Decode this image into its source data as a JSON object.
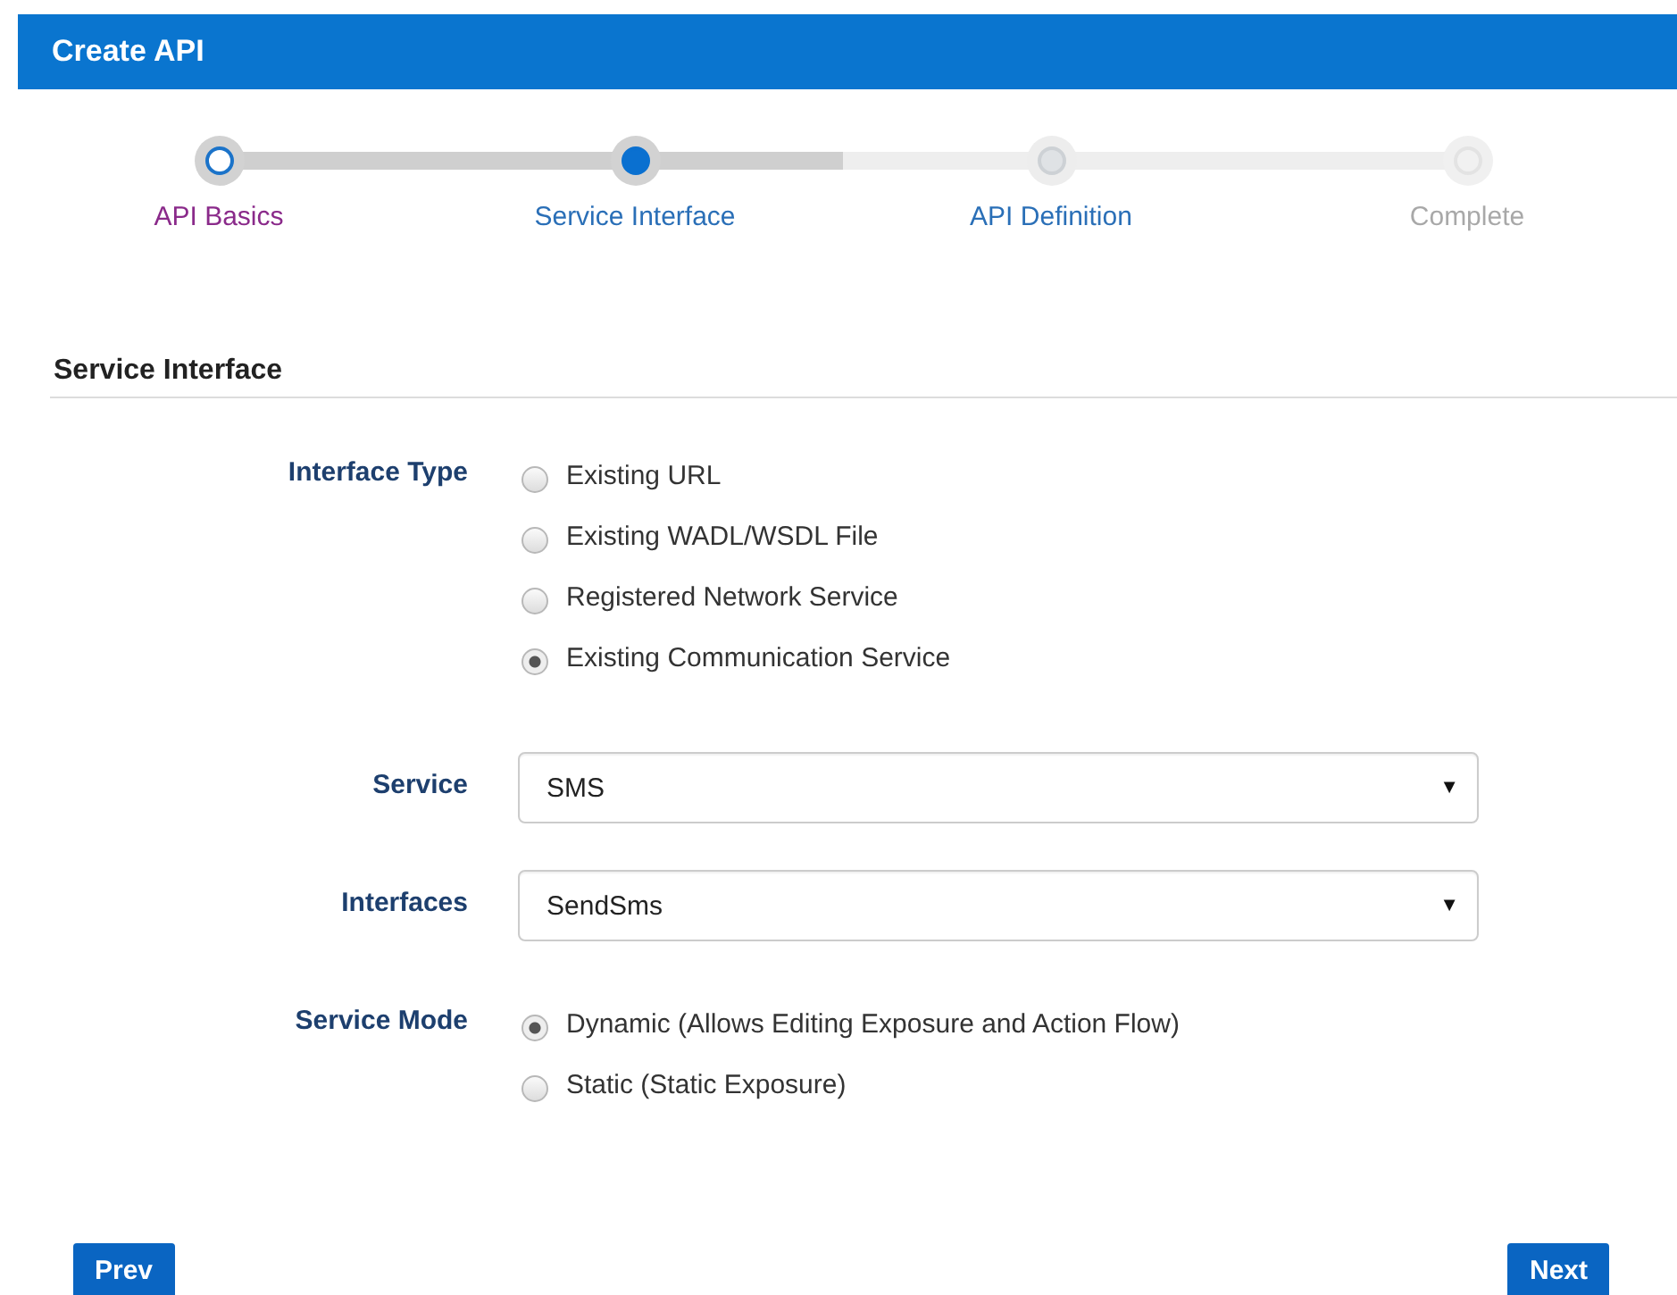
{
  "header": {
    "title": "Create API"
  },
  "steps": [
    {
      "label": "API Basics",
      "completed": true,
      "selected": false,
      "disabled": false
    },
    {
      "label": "Service Interface",
      "completed": false,
      "selected": true,
      "disabled": false
    },
    {
      "label": "API Definition",
      "completed": false,
      "selected": false,
      "disabled": false
    },
    {
      "label": "Complete",
      "completed": false,
      "selected": false,
      "disabled": true
    }
  ],
  "section": {
    "title": "Service Interface"
  },
  "form": [
    {
      "kind": "radio",
      "label": "Interface Type",
      "options": [
        {
          "label": "Existing URL",
          "selected": false
        },
        {
          "label": "Existing WADL/WSDL File",
          "selected": false
        },
        {
          "label": "Registered Network Service",
          "selected": false
        },
        {
          "label": "Existing Communication Service",
          "selected": true
        }
      ]
    },
    {
      "kind": "select",
      "label": "Service",
      "value": "SMS",
      "arrow": "▼"
    },
    {
      "kind": "select",
      "label": "Interfaces",
      "value": "SendSms",
      "arrow": "▼"
    },
    {
      "kind": "radio",
      "label": "Service Mode",
      "options": [
        {
          "label": "Dynamic (Allows Editing Exposure and Action Flow)",
          "selected": true
        },
        {
          "label": "Static (Static Exposure)",
          "selected": false
        }
      ]
    }
  ],
  "buttons": {
    "prev": "Prev",
    "next": "Next"
  }
}
